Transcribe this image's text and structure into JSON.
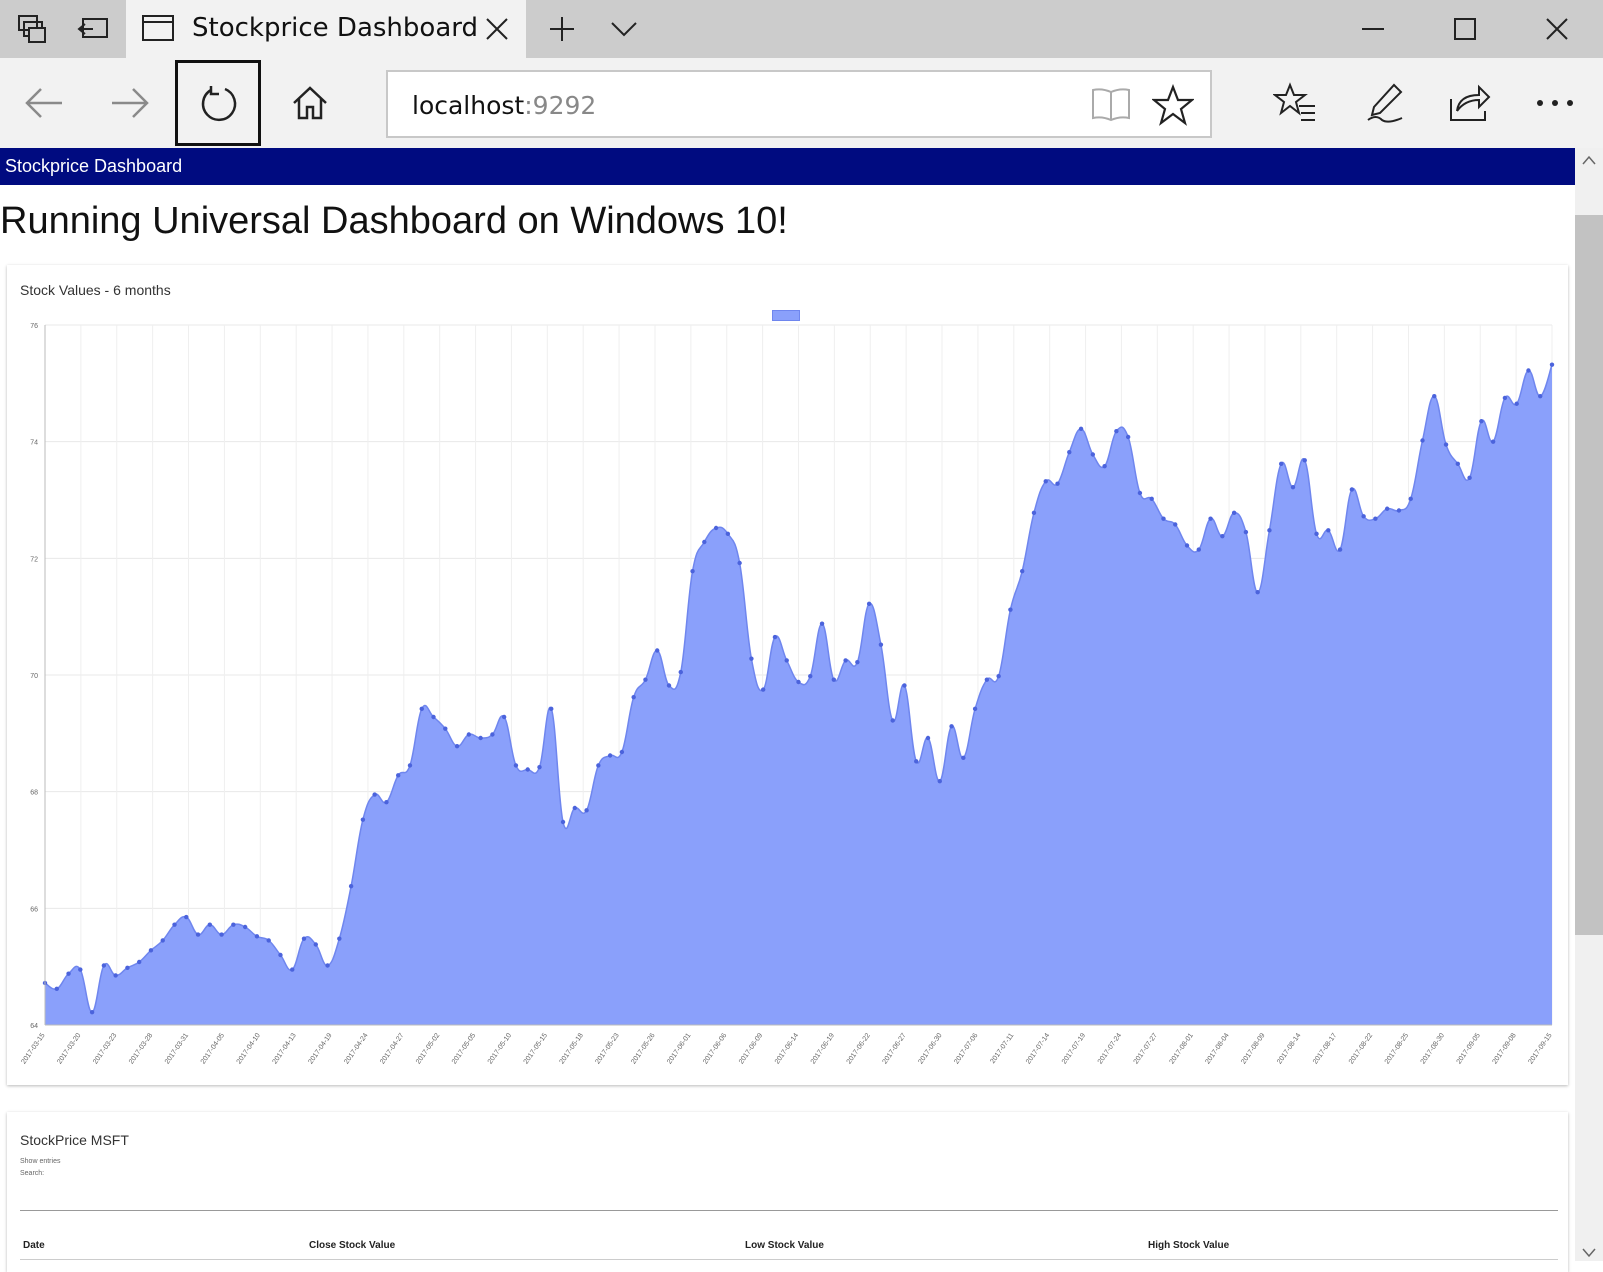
{
  "browser": {
    "tab": {
      "title": "Stockprice Dashboard"
    },
    "url": {
      "host": "localhost",
      "port": ":9292"
    }
  },
  "app": {
    "bar_title": "Stockprice Dashboard",
    "heading": "Running Universal Dashboard on Windows 10!"
  },
  "chart_card": {
    "title": "Stock Values - 6 months"
  },
  "table_card": {
    "title": "StockPrice MSFT",
    "show_entries": "Show entries",
    "search": "Search:",
    "columns": [
      "Date",
      "Close Stock Value",
      "Low Stock Value",
      "High Stock Value"
    ]
  },
  "colors": {
    "accent": "#000b80",
    "area_fill": "#8aa0fb",
    "line": "#6f86ee",
    "point": "#4b63dc"
  },
  "chart_data": {
    "type": "area",
    "title": "Stock Values - 6 months",
    "xlabel": "",
    "ylabel": "",
    "ylim": [
      64,
      76
    ],
    "yticks": [
      64,
      66,
      68,
      70,
      72,
      74,
      76
    ],
    "grid": true,
    "legend": "top-center",
    "x_tick_labels": [
      "2017-03-15",
      "2017-03-20",
      "2017-03-23",
      "2017-03-28",
      "2017-03-31",
      "2017-04-05",
      "2017-04-10",
      "2017-04-13",
      "2017-04-19",
      "2017-04-24",
      "2017-04-27",
      "2017-05-02",
      "2017-05-05",
      "2017-05-10",
      "2017-05-15",
      "2017-05-18",
      "2017-05-23",
      "2017-05-26",
      "2017-06-01",
      "2017-06-06",
      "2017-06-09",
      "2017-06-14",
      "2017-06-19",
      "2017-06-22",
      "2017-06-27",
      "2017-06-30",
      "2017-07-06",
      "2017-07-11",
      "2017-07-14",
      "2017-07-19",
      "2017-07-24",
      "2017-07-27",
      "2017-08-01",
      "2017-08-04",
      "2017-08-09",
      "2017-08-14",
      "2017-08-17",
      "2017-08-22",
      "2017-08-25",
      "2017-08-30",
      "2017-09-05",
      "2017-09-08",
      "2017-09-15"
    ],
    "series": [
      {
        "name": "",
        "values": [
          64.72,
          64.62,
          64.88,
          64.95,
          64.22,
          65.02,
          64.85,
          64.98,
          65.08,
          65.28,
          65.45,
          65.72,
          65.85,
          65.55,
          65.72,
          65.55,
          65.72,
          65.68,
          65.52,
          65.45,
          65.2,
          64.95,
          65.48,
          65.38,
          65.02,
          65.48,
          66.38,
          67.52,
          67.95,
          67.82,
          68.28,
          68.45,
          69.42,
          69.28,
          69.08,
          68.78,
          68.98,
          68.92,
          68.98,
          69.28,
          68.45,
          68.38,
          68.42,
          69.42,
          67.48,
          67.72,
          67.68,
          68.45,
          68.62,
          68.68,
          69.62,
          69.92,
          70.42,
          69.82,
          70.05,
          71.78,
          72.28,
          72.52,
          72.42,
          71.92,
          70.28,
          69.75,
          70.65,
          70.25,
          69.88,
          69.98,
          70.88,
          69.92,
          70.25,
          70.22,
          71.22,
          70.52,
          69.22,
          69.82,
          68.52,
          68.92,
          68.18,
          69.12,
          68.58,
          69.42,
          69.92,
          69.98,
          71.12,
          71.78,
          72.78,
          73.32,
          73.28,
          73.82,
          74.22,
          73.78,
          73.58,
          74.18,
          74.08,
          73.12,
          73.02,
          72.68,
          72.58,
          72.22,
          72.15,
          72.68,
          72.38,
          72.78,
          72.45,
          71.42,
          72.48,
          73.62,
          73.22,
          73.68,
          72.42,
          72.48,
          72.15,
          73.18,
          72.72,
          72.68,
          72.85,
          72.82,
          73.02,
          74.02,
          74.78,
          73.95,
          73.62,
          73.38,
          74.35,
          74.0,
          74.75,
          74.65,
          75.22,
          74.78,
          75.32
        ]
      }
    ]
  }
}
